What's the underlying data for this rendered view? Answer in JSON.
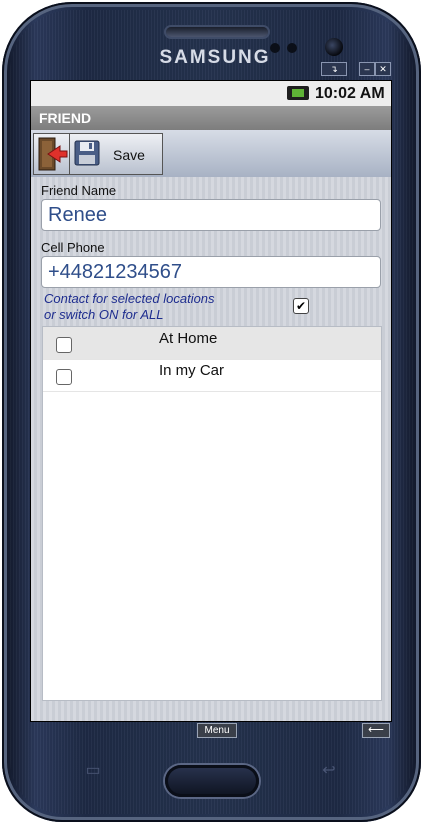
{
  "device": {
    "brand": "SAMSUNG",
    "window_controls": [
      "↴",
      "–",
      "✕"
    ]
  },
  "status_bar": {
    "time": "10:02 AM"
  },
  "title_bar": {
    "title": "FRIEND"
  },
  "toolbar": {
    "save_label": "Save"
  },
  "form": {
    "name_label": "Friend Name",
    "name_value": "Renee",
    "phone_label": "Cell Phone",
    "phone_value": "+44821234567",
    "note_line1": "Contact for selected locations",
    "note_line2": "or  switch ON for ALL",
    "all_checked": true,
    "all_check_glyph": "✔"
  },
  "locations": [
    {
      "label": "At Home",
      "checked": false
    },
    {
      "label": "In my Car",
      "checked": false
    }
  ],
  "nav": {
    "menu_label": "Menu",
    "back_glyph": "⟵"
  },
  "colors": {
    "title_bar": "#8b8b8b",
    "field_text": "#2f4e8a",
    "note_text": "#1e2d8f",
    "toolbar": "#b4bdcd"
  }
}
